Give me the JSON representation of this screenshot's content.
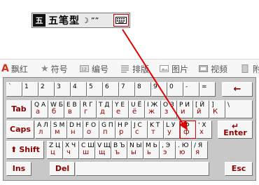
{
  "ime_bar": {
    "logo_text": "五",
    "input_method": "五笔型",
    "moon_icon": "☽",
    "punct_icon": "””",
    "keyboard_icon": "soft-keyboard-icon"
  },
  "toolbar": {
    "items": [
      {
        "label": "飘红",
        "icon": "logo-a-icon"
      },
      {
        "label": "符号",
        "icon": "star-icon"
      },
      {
        "label": "编号",
        "icon": "numbering-icon"
      },
      {
        "label": "排版",
        "icon": "layout-icon"
      },
      {
        "label": "图片",
        "icon": "image-icon"
      },
      {
        "label": "视频",
        "icon": "video-icon"
      },
      {
        "label": "附",
        "icon": "attachment-icon"
      }
    ]
  },
  "keyboard": {
    "row1": [
      {
        "up": "`",
        "ru": ""
      },
      {
        "up": "1",
        "ru": ""
      },
      {
        "up": "2",
        "ru": ""
      },
      {
        "up": "3",
        "ru": ""
      },
      {
        "up": "4",
        "ru": ""
      },
      {
        "up": "5",
        "ru": ""
      },
      {
        "up": "6",
        "ru": ""
      },
      {
        "up": "7",
        "ru": ""
      },
      {
        "up": "8",
        "ru": ""
      },
      {
        "up": "9",
        "ru": ""
      },
      {
        "up": "0",
        "ru": ""
      },
      {
        "up": "-",
        "ru": ""
      },
      {
        "up": "=",
        "ru": ""
      }
    ],
    "row2": [
      {
        "up": "Q А",
        "ru": "а"
      },
      {
        "up": "W Б",
        "ru": "б"
      },
      {
        "up": "E В",
        "ru": "в"
      },
      {
        "up": "R Г",
        "ru": "г"
      },
      {
        "up": "T Д",
        "ru": "д"
      },
      {
        "up": "Y Е",
        "ru": "е"
      },
      {
        "up": "U Ё",
        "ru": "ё"
      },
      {
        "up": "I Ж",
        "ru": "ж"
      },
      {
        "up": "O З",
        "ru": "з"
      },
      {
        "up": "P И",
        "ru": "и"
      },
      {
        "up": "[ Й",
        "ru": "й"
      },
      {
        "up": "] ",
        "ru": "К"
      },
      {
        "up": "\\",
        "ru": ""
      }
    ],
    "row3": [
      {
        "up": "A Л",
        "ru": "л"
      },
      {
        "up": "S М",
        "ru": "м"
      },
      {
        "up": "D Н",
        "ru": "н"
      },
      {
        "up": "F О",
        "ru": "о"
      },
      {
        "up": "G П",
        "ru": "п"
      },
      {
        "up": "H Р",
        "ru": "р"
      },
      {
        "up": "J С",
        "ru": "с"
      },
      {
        "up": "K Т",
        "ru": "т"
      },
      {
        "up": "L У",
        "ru": "у"
      },
      {
        "up": ";Ф",
        "ru": "ф"
      },
      {
        "up": "' X",
        "ru": "х"
      }
    ],
    "row4": [
      {
        "up": "Z Ц",
        "ru": "ц"
      },
      {
        "up": "X Ч",
        "ru": "ч"
      },
      {
        "up": "C Ш",
        "ru": "ш"
      },
      {
        "up": "V Щ",
        "ru": "щ"
      },
      {
        "up": "B Ъ",
        "ru": "ъ"
      },
      {
        "up": "N Ы",
        "ru": "ы"
      },
      {
        "up": "M Ь",
        "ru": "ь"
      },
      {
        "up": ", Э",
        "ru": "э"
      },
      {
        "up": ". Ю",
        "ru": "ю"
      },
      {
        "up": "/ Я",
        "ru": "я"
      }
    ],
    "func": {
      "backspace": "←",
      "tab": "Tab",
      "caps": "Caps",
      "enter": "Enter",
      "shift": "Shift",
      "ins": "Ins",
      "del": "Del",
      "esc": "Esc"
    }
  },
  "colors": {
    "accent": "#8b0000",
    "arrow": "#e00000"
  }
}
